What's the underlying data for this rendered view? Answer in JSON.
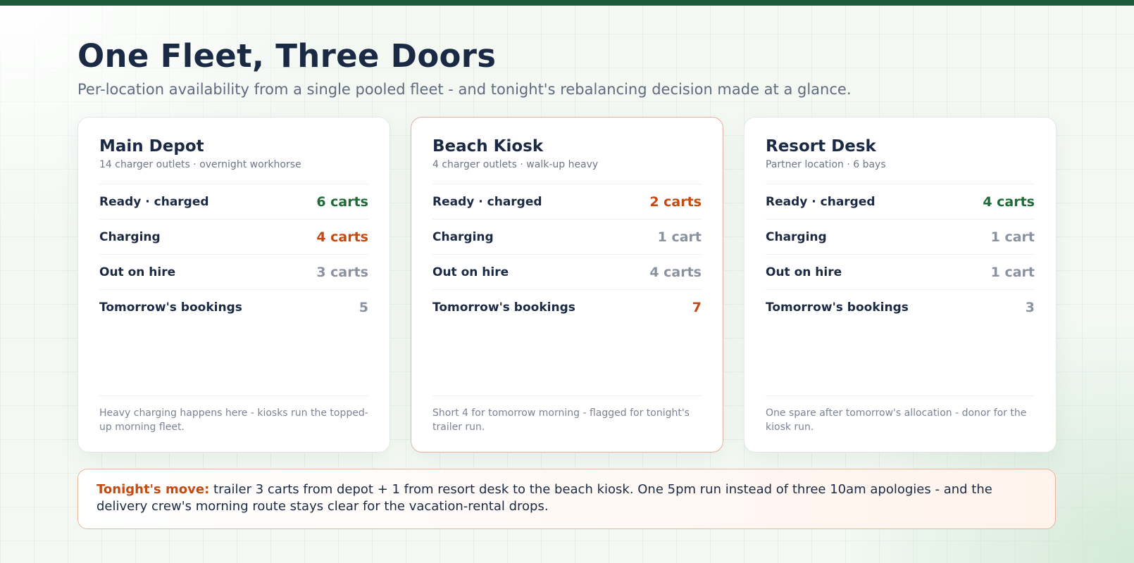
{
  "colors": {
    "accent_bar": "#1f5a38",
    "good": "#1e6b38",
    "warn": "#c44a12",
    "muted": "#8a92a0",
    "text": "#1b2a44"
  },
  "header": {
    "title": "One Fleet, Three Doors",
    "subtitle": "Per-location availability from a single pooled fleet - and tonight's rebalancing decision made at a glance."
  },
  "locations": [
    {
      "name": "Main Depot",
      "meta": "14 charger outlets · overnight workhorse",
      "rows": [
        {
          "label": "Ready · charged",
          "value": "6 carts",
          "status": "green"
        },
        {
          "label": "Charging",
          "value": "4 carts",
          "status": "orange"
        },
        {
          "label": "Out on hire",
          "value": "3 carts",
          "status": "gray"
        },
        {
          "label": "Tomorrow's bookings",
          "value": "5",
          "status": "gray"
        }
      ],
      "note": "Heavy charging happens here - kiosks run the topped-up morning fleet."
    },
    {
      "name": "Beach Kiosk",
      "meta": "4 charger outlets · walk-up heavy",
      "rows": [
        {
          "label": "Ready · charged",
          "value": "2 carts",
          "status": "orange"
        },
        {
          "label": "Charging",
          "value": "1 cart",
          "status": "gray"
        },
        {
          "label": "Out on hire",
          "value": "4 carts",
          "status": "gray"
        },
        {
          "label": "Tomorrow's bookings",
          "value": "7",
          "status": "orange"
        }
      ],
      "note": "Short 4 for tomorrow morning - flagged for tonight's trailer run."
    },
    {
      "name": "Resort Desk",
      "meta": "Partner location · 6 bays",
      "rows": [
        {
          "label": "Ready · charged",
          "value": "4 carts",
          "status": "green"
        },
        {
          "label": "Charging",
          "value": "1 cart",
          "status": "gray"
        },
        {
          "label": "Out on hire",
          "value": "1 cart",
          "status": "gray"
        },
        {
          "label": "Tomorrow's bookings",
          "value": "3",
          "status": "gray"
        }
      ],
      "note": "One spare after tomorrow's allocation - donor for the kiosk run."
    }
  ],
  "tonight_move": {
    "label": "Tonight's move:",
    "text": "trailer 3 carts from depot + 1 from resort desk to the beach kiosk. One 5pm run instead of three 10am apologies - and the delivery crew's morning route stays clear for the vacation-rental drops."
  }
}
